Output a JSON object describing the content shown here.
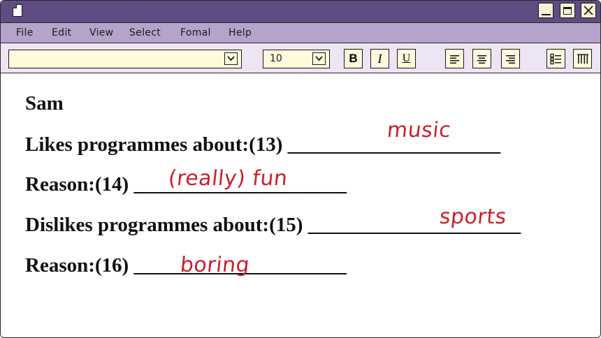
{
  "menu": {
    "items": [
      "File",
      "Edit",
      "View",
      "Select",
      "Fomal",
      "Help"
    ]
  },
  "toolbar": {
    "font_name": "",
    "font_size": "10",
    "bold_label": "B",
    "italic_label": "I",
    "underline_label": "U"
  },
  "document": {
    "name": "Sam",
    "lines": [
      {
        "label": "Likes programmes about:(13)",
        "blank": "_____________________",
        "answer": "music"
      },
      {
        "label": "Reason:(14)",
        "blank": "_____________________",
        "answer": "(really) fun"
      },
      {
        "label": "Dislikes programmes about:(15)",
        "blank": "_____________________",
        "answer": "sports"
      },
      {
        "label": "Reason:(16)",
        "blank": "_____________________",
        "answer": "boring"
      }
    ]
  },
  "colors": {
    "titlebar": "#5e4c82",
    "menubar": "#b5a3cb",
    "toolbar": "#ede4f4",
    "field": "#fff9dd",
    "answer": "#cc1f2c"
  },
  "icons": {
    "document": "document-icon",
    "minimize": "minimize-icon",
    "maximize": "maximize-icon",
    "close": "close-icon",
    "dropdown": "chevron-down-icon",
    "align_left": "align-left-icon",
    "align_center": "align-center-icon",
    "align_right": "align-right-icon",
    "list": "bullet-list-icon",
    "columns": "columns-icon"
  }
}
